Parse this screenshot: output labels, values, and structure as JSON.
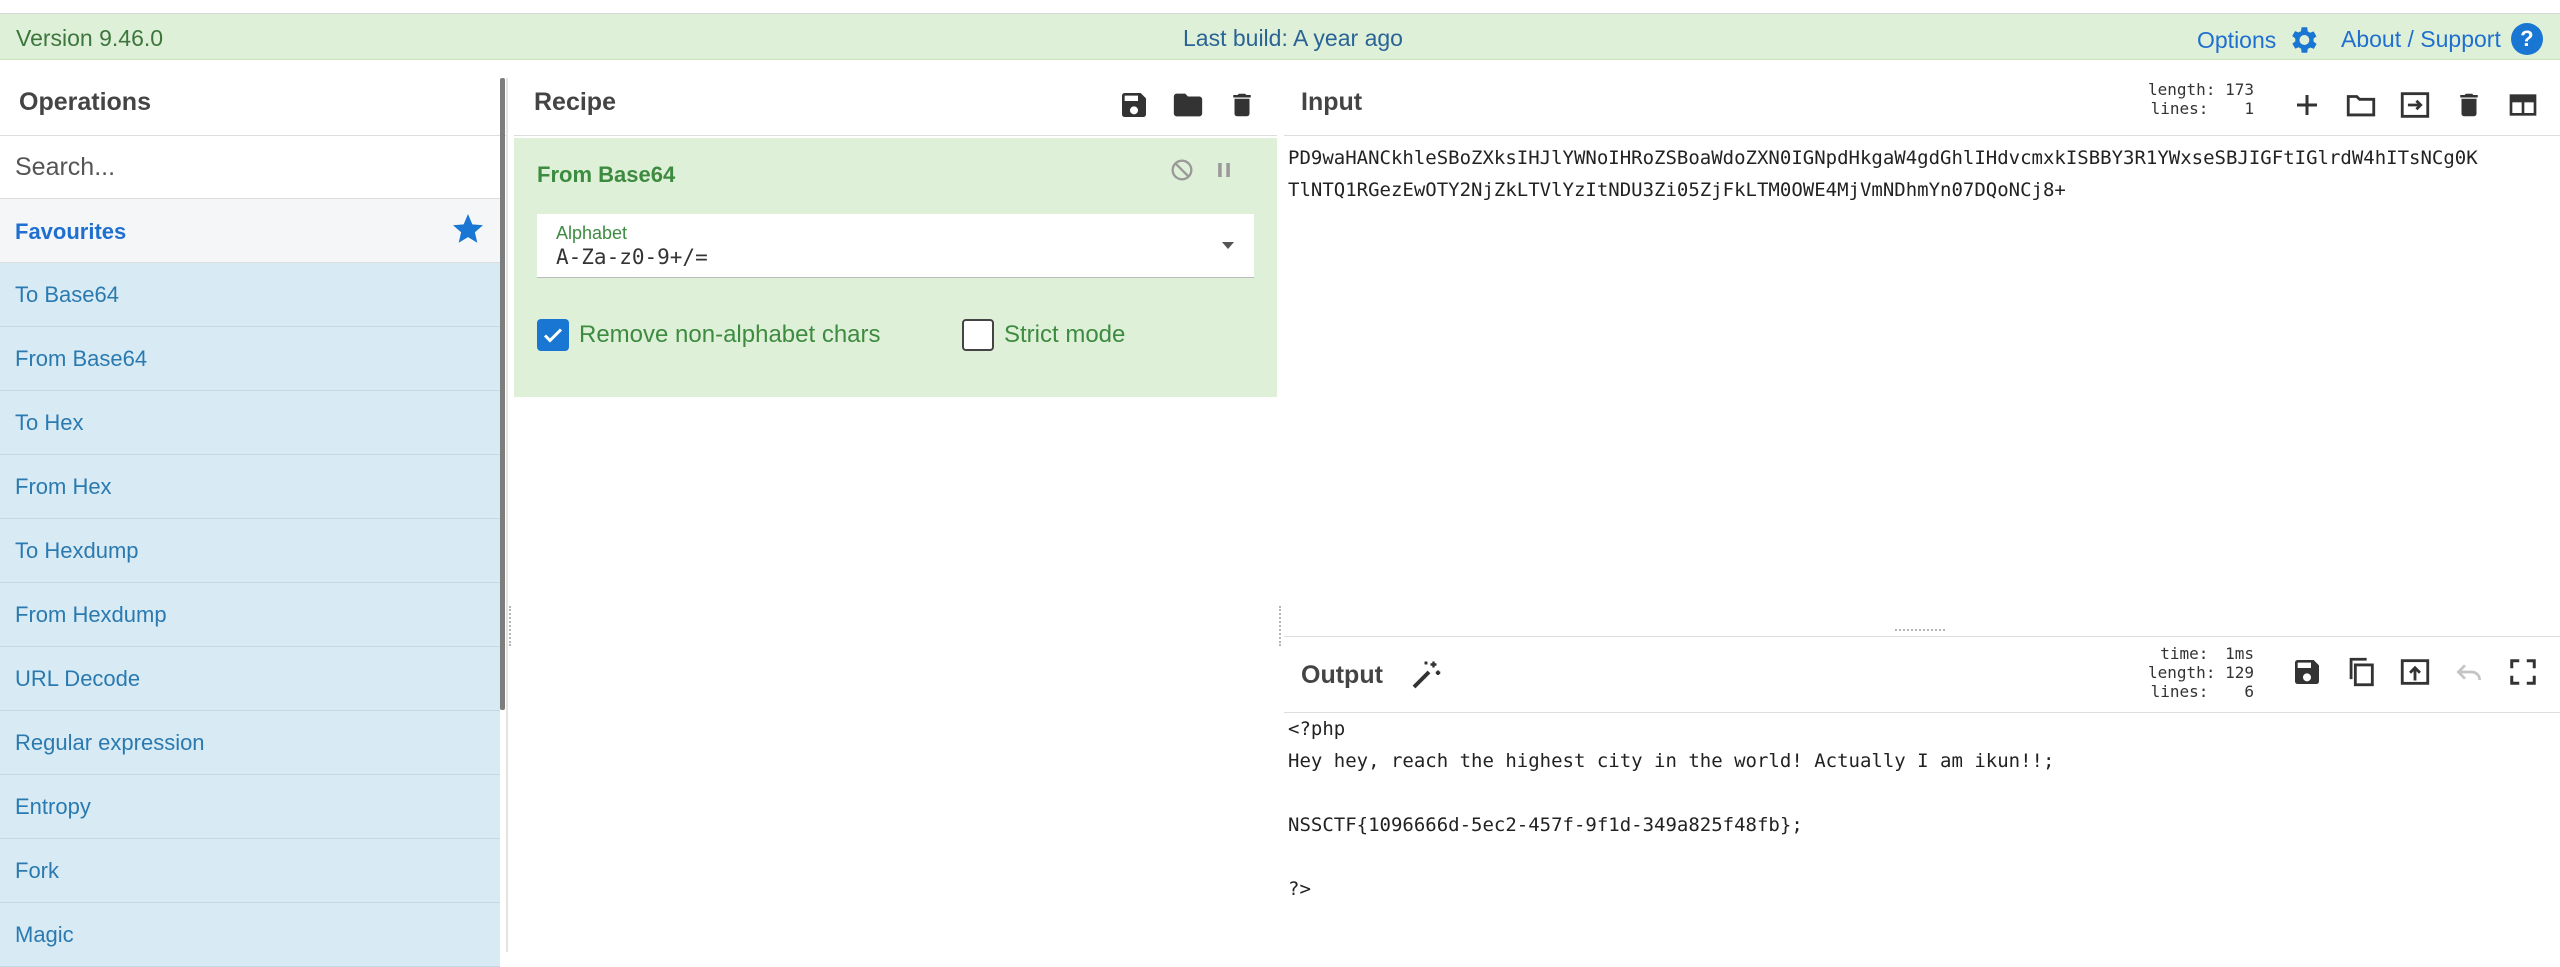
{
  "banner": {
    "version": "Version 9.46.0",
    "last_build": "Last build: A year ago",
    "options": "Options",
    "about": "About / Support"
  },
  "operations": {
    "title": "Operations",
    "search_placeholder": "Search...",
    "favourites": "Favourites",
    "items": [
      "To Base64",
      "From Base64",
      "To Hex",
      "From Hex",
      "To Hexdump",
      "From Hexdump",
      "URL Decode",
      "Regular expression",
      "Entropy",
      "Fork",
      "Magic"
    ]
  },
  "recipe": {
    "title": "Recipe",
    "operation": {
      "name": "From Base64",
      "alphabet_label": "Alphabet",
      "alphabet_value": "A-Za-z0-9+/=",
      "remove_non_alphabet": "Remove non-alphabet chars",
      "remove_non_alphabet_checked": true,
      "strict_mode": "Strict mode",
      "strict_mode_checked": false
    }
  },
  "input": {
    "title": "Input",
    "length_label": "length:",
    "length": "173",
    "lines_label": "lines:",
    "lines": "1",
    "text": "PD9waHANCkhleSBoZXksIHJlYWNoIHRoZSBoaWdoZXN0IGNpdHkgaW4gdGhlIHdvcmxkISBBY3R1YWxseSBJIGFtIGlrdW4hITsNCg0KTlNTQ1RGezEwOTY2NjZkLTVlYzItNDU3Zi05ZjFkLTM0OWE4MjVmNDhmYn07DQoNCj8+"
  },
  "output": {
    "title": "Output",
    "time_label": "time:",
    "time": "1ms",
    "length_label": "length:",
    "length": "129",
    "lines_label": "lines:",
    "lines": "6",
    "text": "<?php\nHey hey, reach the highest city in the world! Actually I am ikun!!;\n\nNSSCTF{1096666d-5ec2-457f-9f1d-349a825f48fb};\n\n?>"
  },
  "colors": {
    "banner_bg": "#dff0d8",
    "recipe_card_bg": "#dff0d8",
    "operation_item_bg": "#d8ebf5",
    "accent_blue": "#1976d2"
  }
}
